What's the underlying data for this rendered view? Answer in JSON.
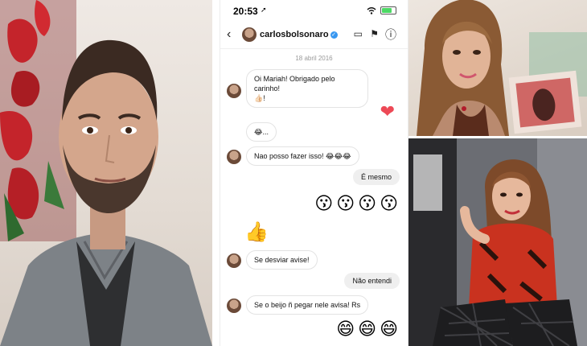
{
  "status_bar": {
    "time": "20:53",
    "location_glyph": "➚"
  },
  "header": {
    "back_icon": "‹",
    "username": "carlosbolsonaro",
    "verified_glyph": "✓",
    "video_icon": "▭",
    "flag_icon": "⚑",
    "info_icon": "ⓘ"
  },
  "date_divider": "18 abril 2016",
  "messages": [
    {
      "from": "carlosbolsonaro",
      "text": "Oi Mariah! Obrigado pelo carinho!",
      "text2": "👍🏻!"
    },
    {
      "from": "me",
      "emoji": "❤"
    },
    {
      "from": "carlosbolsonaro",
      "text": "😂..."
    },
    {
      "from": "carlosbolsonaro",
      "text": "Nao posso fazer isso! 😂😂😂"
    },
    {
      "from": "me",
      "text": "É mesmo"
    },
    {
      "from": "me",
      "emojis": [
        "😗",
        "😗",
        "😗",
        "😗"
      ]
    },
    {
      "from": "carlosbolsonaro",
      "emoji": "👍"
    },
    {
      "from": "carlosbolsonaro",
      "text": "Se desviar avise!"
    },
    {
      "from": "me",
      "text": "Não entendi"
    },
    {
      "from": "carlosbolsonaro",
      "text": "Se o beijo ñ pegar nele avisa! Rs"
    },
    {
      "from": "me",
      "emojis": [
        "😄",
        "😄",
        "😄"
      ]
    }
  ],
  "colors": {
    "heart": "#ed4956",
    "verified": "#3897f0",
    "outgoing_bubble": "#efefef"
  }
}
